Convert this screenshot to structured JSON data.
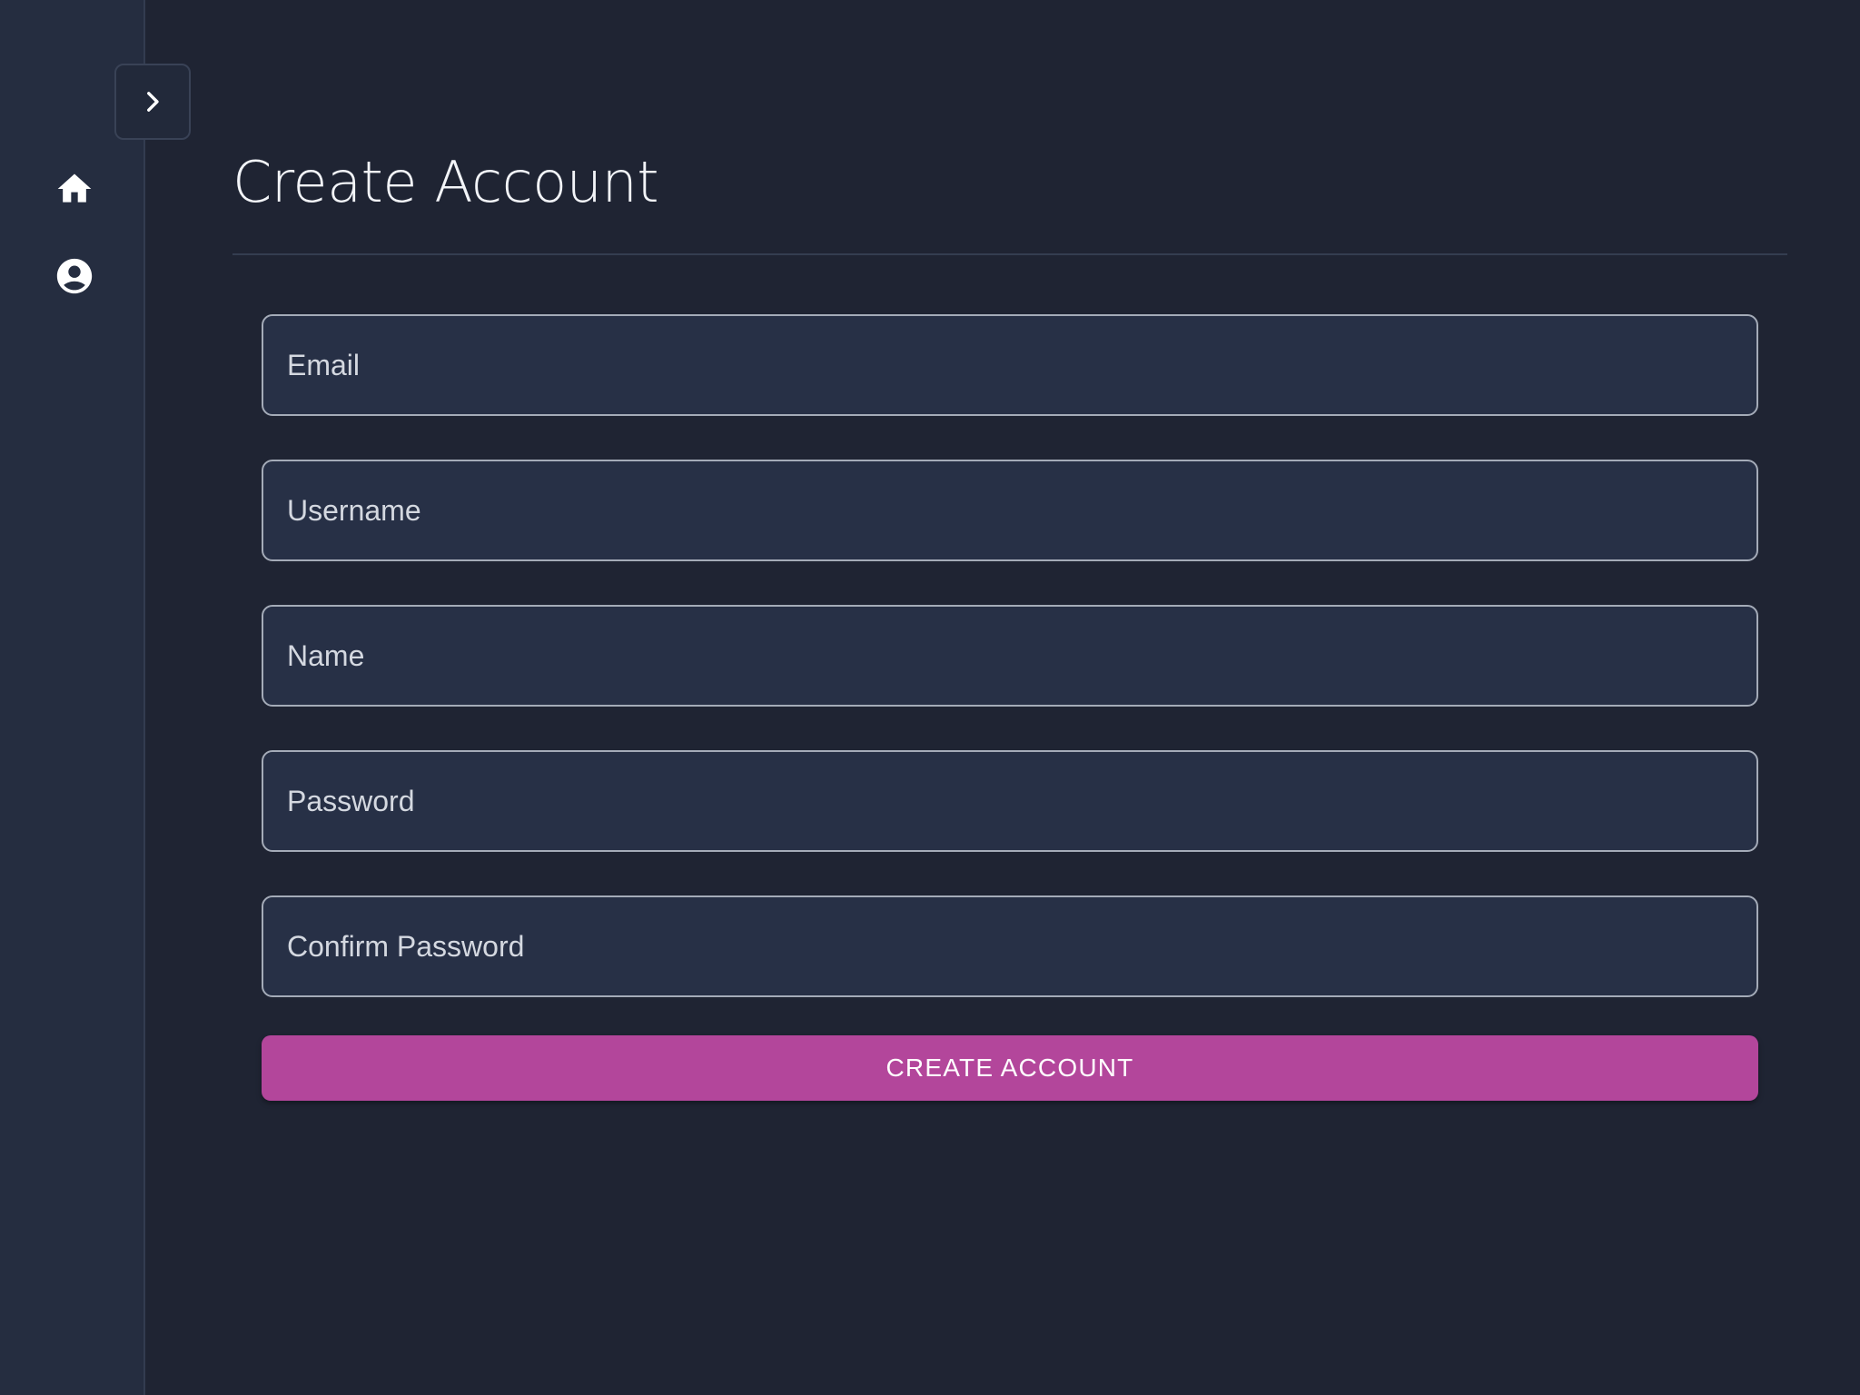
{
  "sidebar": {
    "toggle": {
      "icon": "chevron-right-icon"
    },
    "items": [
      {
        "id": "home",
        "icon": "home-icon"
      },
      {
        "id": "account",
        "icon": "account-circle-icon"
      }
    ]
  },
  "page": {
    "title": "Create Account"
  },
  "form": {
    "fields": [
      {
        "id": "email",
        "placeholder": "Email",
        "value": ""
      },
      {
        "id": "username",
        "placeholder": "Username",
        "value": ""
      },
      {
        "id": "name",
        "placeholder": "Name",
        "value": ""
      },
      {
        "id": "password",
        "placeholder": "Password",
        "value": ""
      },
      {
        "id": "confirm_password",
        "placeholder": "Confirm Password",
        "value": ""
      }
    ],
    "submit_label": "CREATE ACCOUNT"
  },
  "colors": {
    "background": "#1f2433",
    "sidebar": "#252d40",
    "field_background": "#273046",
    "field_border": "#a4abb8",
    "accent": "#b3469b"
  }
}
